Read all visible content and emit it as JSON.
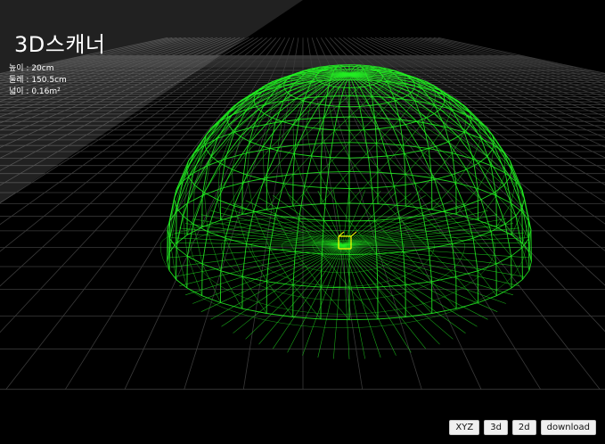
{
  "app": {
    "title": "3D스캐너"
  },
  "stats": [
    {
      "label": "높이",
      "value": "20cm"
    },
    {
      "label": "둘레",
      "value": "150.5cm"
    },
    {
      "label": "넓이",
      "value": "0.16m²"
    }
  ],
  "toolbar": {
    "xyz_label": "XYZ",
    "view3d_label": "3d",
    "view2d_label": "2d",
    "download_label": "download"
  },
  "scene": {
    "background_color": "#000000",
    "grid_color": "#3a3a3a",
    "mesh_color": "#22ee22",
    "axes_marker_color": "#ffff00",
    "panel_overlay_color": "#ffffff"
  }
}
